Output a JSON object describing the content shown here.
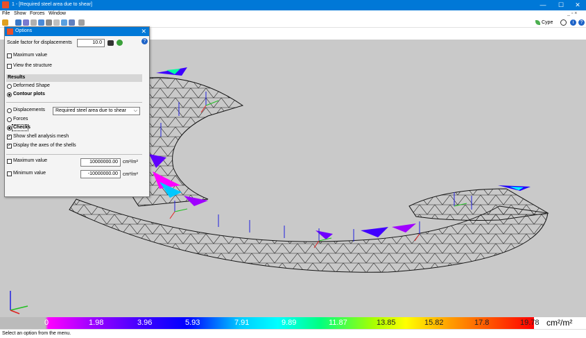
{
  "window": {
    "title": "1 - [Required steel area due to shear]",
    "minimize": "—",
    "maximize": "☐",
    "close": "✕"
  },
  "menu": {
    "items": [
      "File",
      "Show",
      "Forces",
      "Window"
    ],
    "mdi_controls": "_ ▫ ×"
  },
  "toolbar": {
    "brand": "Cype"
  },
  "dialog": {
    "title": "Options",
    "scale_label": "Scale factor for displacements",
    "scale_value": "10.0",
    "maximum_value_check": "Maximum value",
    "view_structure_check": "View the structure",
    "results_header": "Results",
    "deformed_shape": "Deformed Shape",
    "contour_plots": "Contour plots",
    "displacements": "Displacements",
    "result_select": "Required steel area due to shear",
    "forces": "Forces",
    "checks": "Checks",
    "show_mesh": "Show shell analysis mesh",
    "display_axes": "Display the axes of the shells",
    "max_label": "Maximum value",
    "max_value": "10000000.00",
    "min_label": "Minimum value",
    "min_value": "-10000000.00",
    "unit": "cm²/m²"
  },
  "legend": {
    "values": [
      "0",
      "1.98",
      "3.96",
      "5.93",
      "7.91",
      "9.89",
      "11.87",
      "13.85",
      "15.82",
      "17.8",
      "19.78"
    ],
    "unit": "cm²/m²",
    "colors": [
      "#bbbbbb",
      "#ff00ff",
      "#3c00ff",
      "#00ffff",
      "#a8ff00",
      "#ffff00",
      "#ffa000",
      "#ff0000"
    ]
  },
  "status": {
    "text": "Select an option from the menu."
  }
}
